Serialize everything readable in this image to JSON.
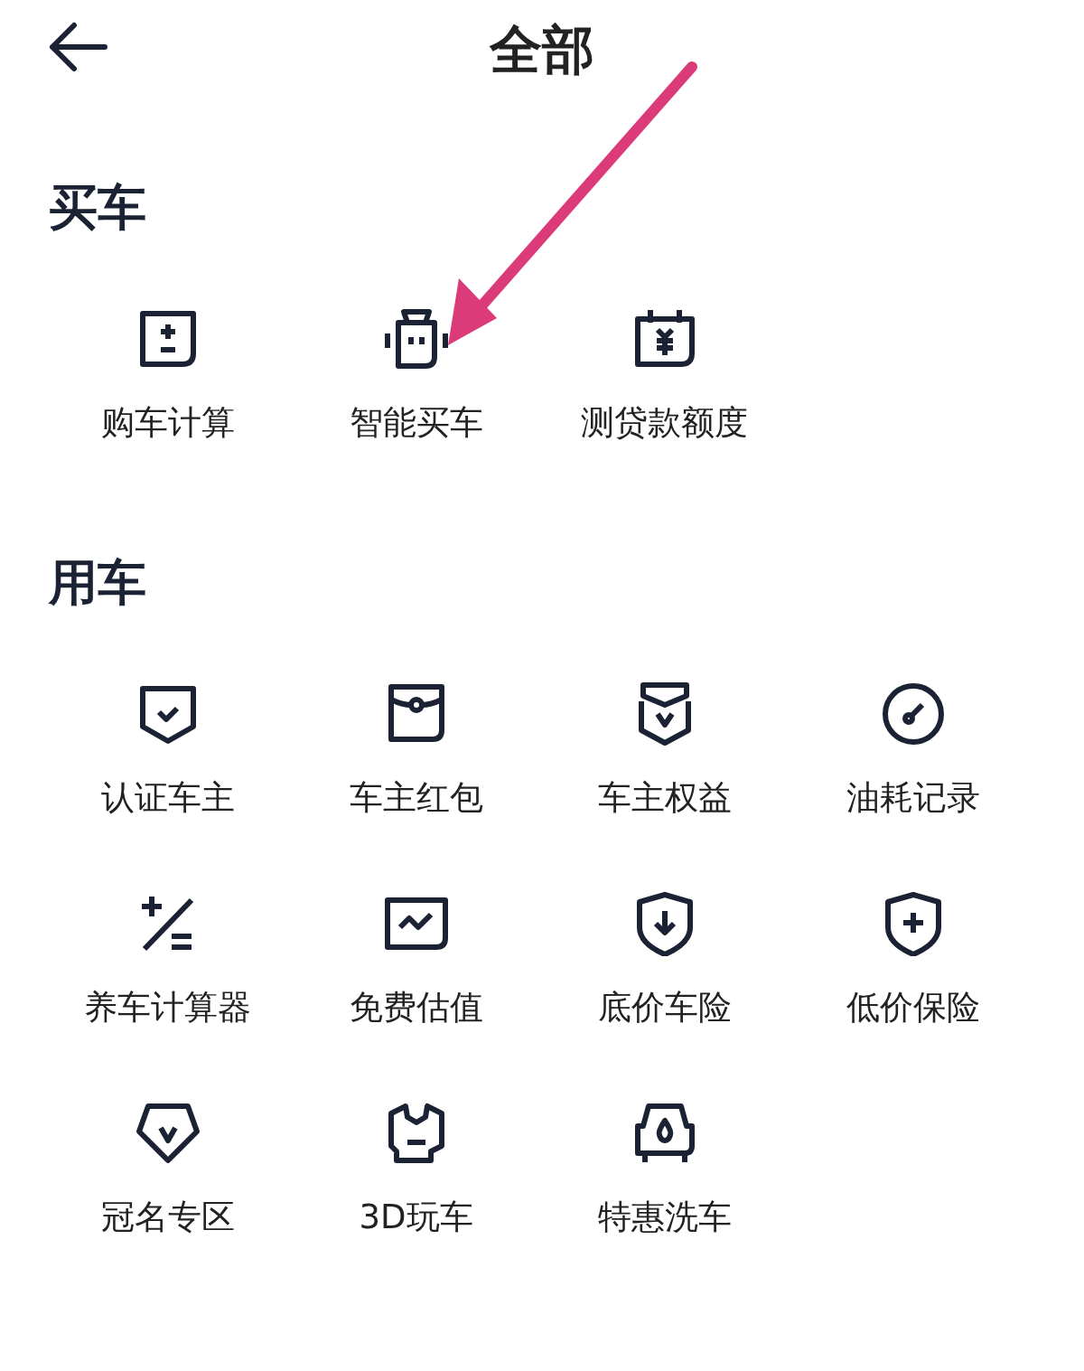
{
  "header": {
    "title": "全部"
  },
  "sections": [
    {
      "title": "买车",
      "items": [
        {
          "label": "购车计算"
        },
        {
          "label": "智能买车"
        },
        {
          "label": "测贷款额度"
        }
      ]
    },
    {
      "title": "用车",
      "items": [
        {
          "label": "认证车主"
        },
        {
          "label": "车主红包"
        },
        {
          "label": "车主权益"
        },
        {
          "label": "油耗记录"
        },
        {
          "label": "养车计算器"
        },
        {
          "label": "免费估值"
        },
        {
          "label": "底价车险"
        },
        {
          "label": "低价保险"
        },
        {
          "label": "冠名专区"
        },
        {
          "label": "3D玩车"
        },
        {
          "label": "特惠洗车"
        }
      ]
    }
  ],
  "annotation": {
    "kind": "arrow"
  }
}
